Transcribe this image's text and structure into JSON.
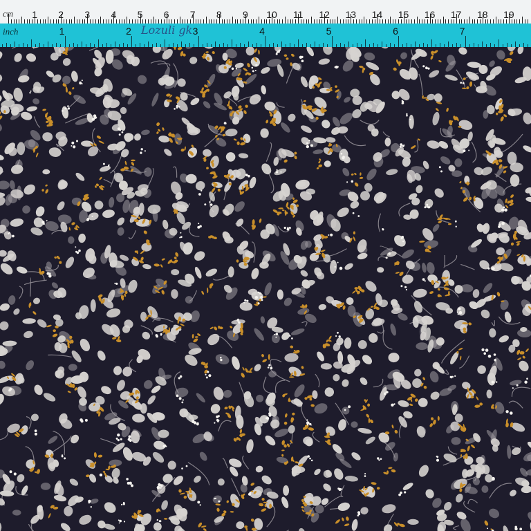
{
  "ruler_cm": {
    "unit_label": "cm",
    "numbers": [
      "1",
      "2",
      "3",
      "4",
      "5",
      "6",
      "7",
      "8",
      "9",
      "10",
      "11",
      "12",
      "13",
      "14",
      "15",
      "16",
      "17",
      "18",
      "19",
      "2"
    ]
  },
  "ruler_inch": {
    "unit_label": "inch",
    "numbers": [
      "1",
      "2",
      "3",
      "4",
      "5",
      "6",
      "7"
    ],
    "handwritten_label": "Lozuli gk"
  },
  "fabric": {
    "background_color": "#1e1c2c",
    "leaf_color_light": "#d6d3d0",
    "leaf_color_mid": "#9e9aa0",
    "floral_color_mustard": "#c98f2a",
    "floral_color_white": "#f4f2ee"
  }
}
